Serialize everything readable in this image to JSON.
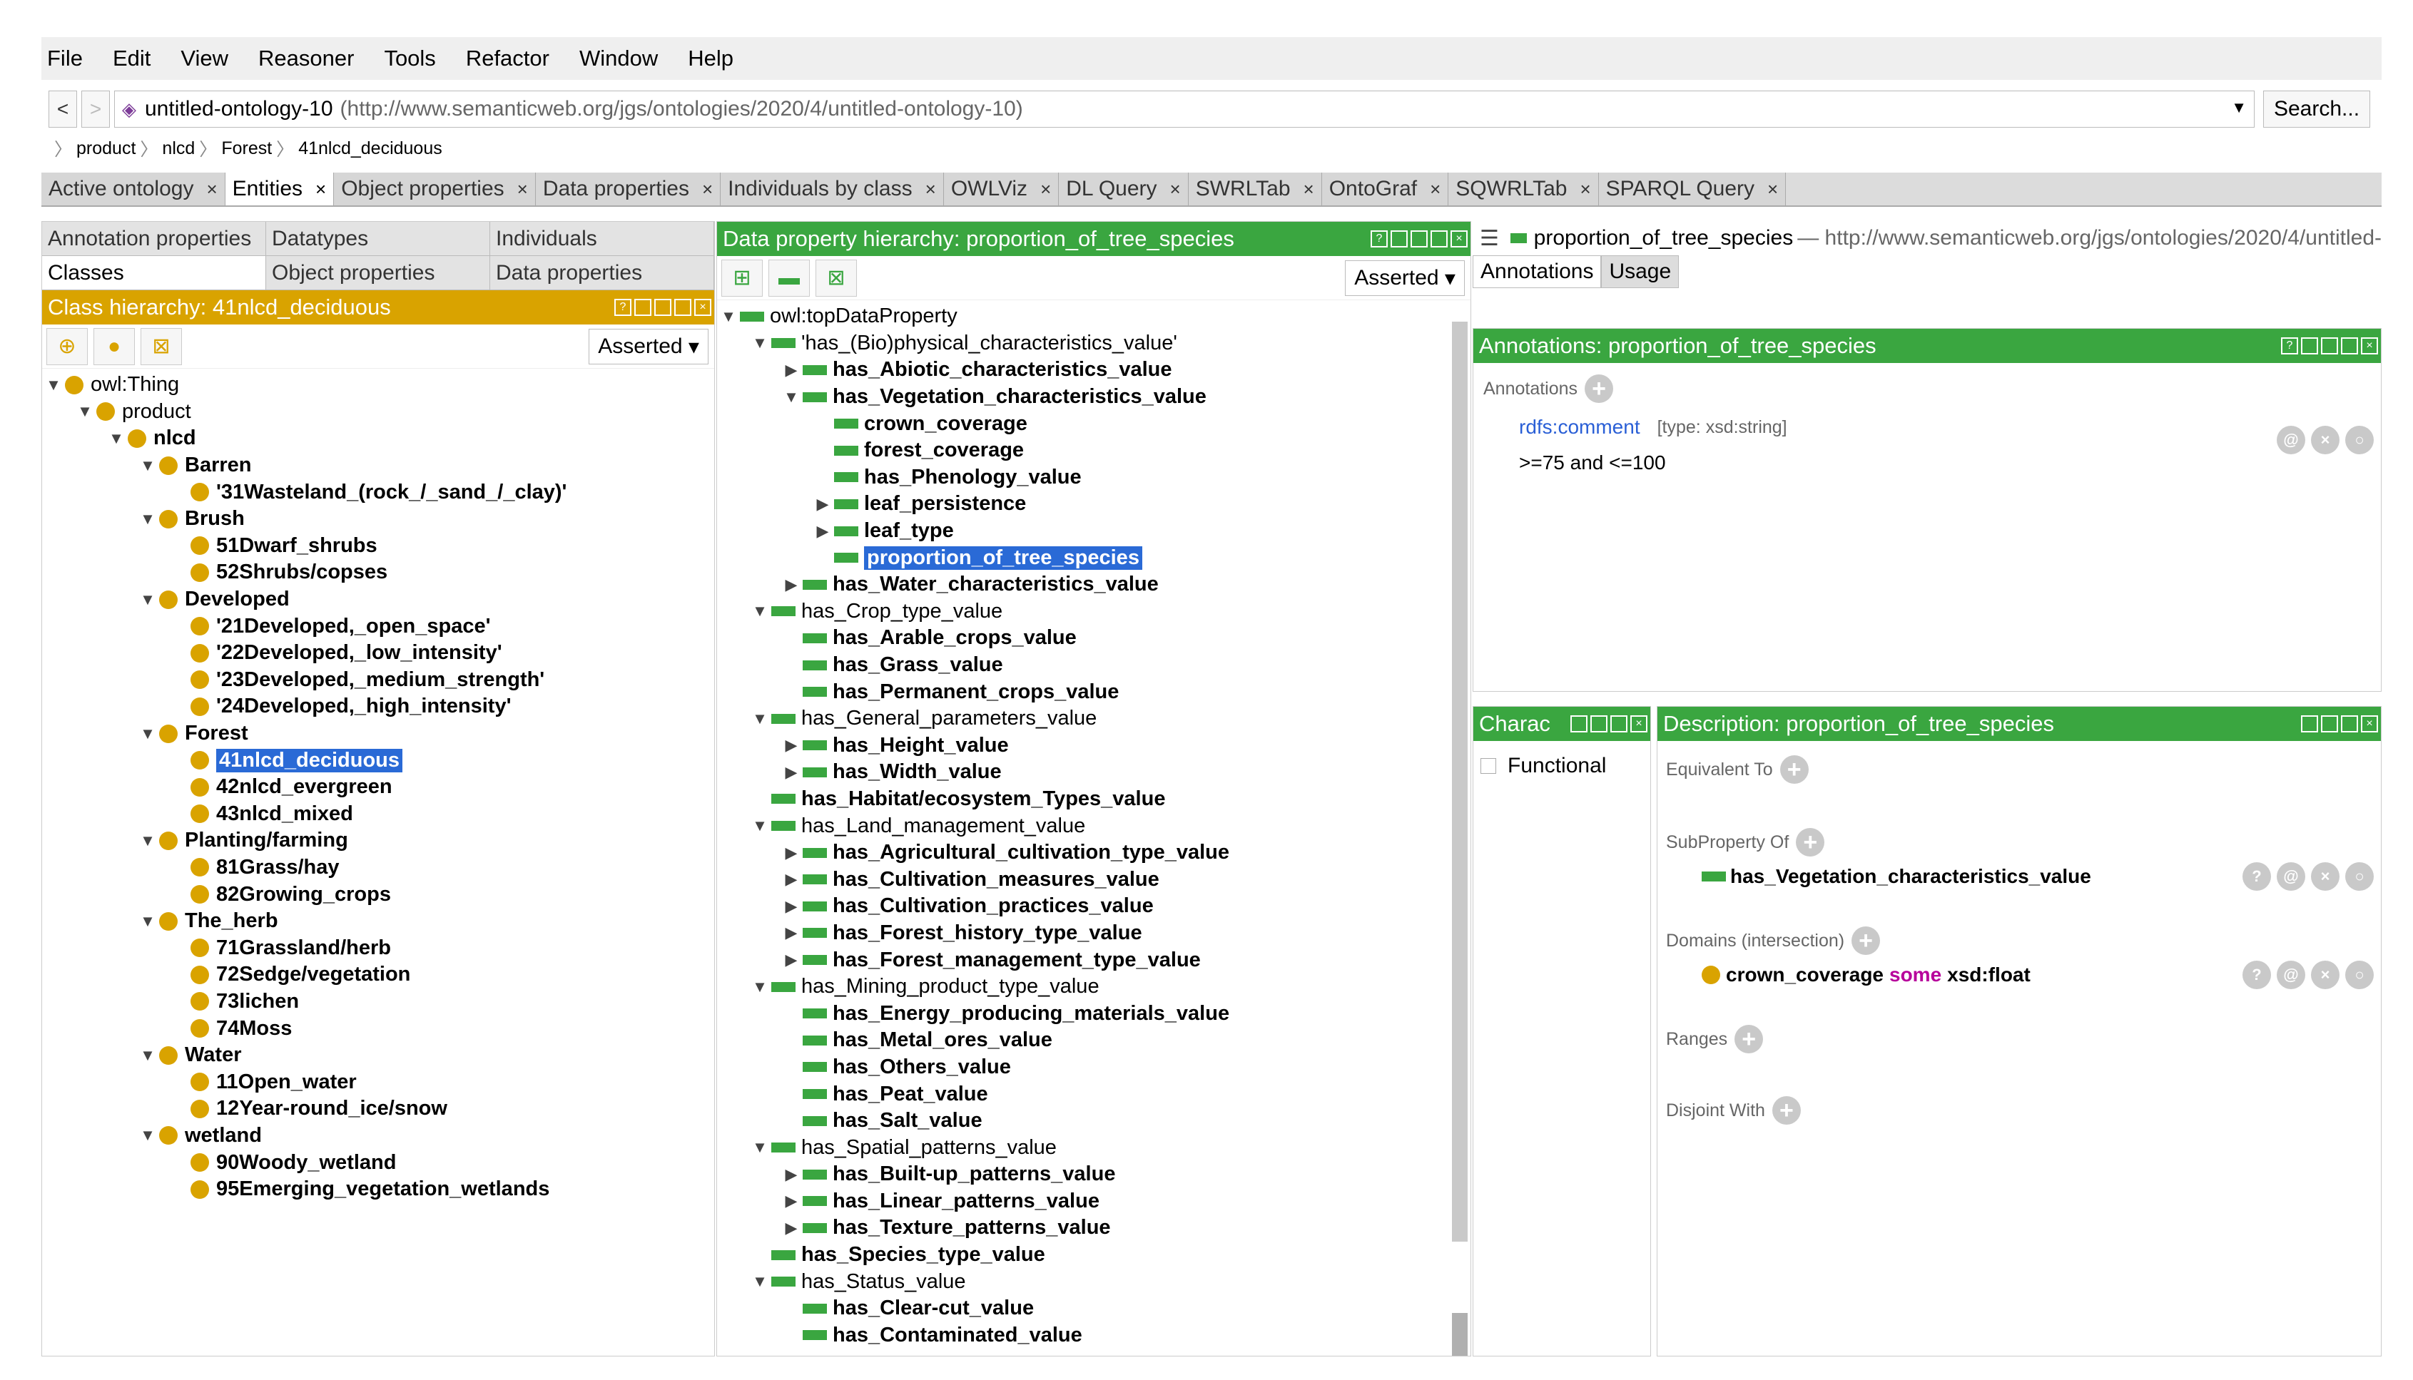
{
  "menu": [
    "File",
    "Edit",
    "View",
    "Reasoner",
    "Tools",
    "Refactor",
    "Window",
    "Help"
  ],
  "address": {
    "back": "<",
    "forward": ">",
    "ontology_name": "untitled-ontology-10",
    "ontology_uri": "(http://www.semanticweb.org/jgs/ontologies/2020/4/untitled-ontology-10)",
    "search_label": "Search..."
  },
  "breadcrumb": [
    "product",
    "nlcd",
    "Forest",
    "41nlcd_deciduous"
  ],
  "workspace_tabs": [
    {
      "label": "Active ontology",
      "active": false
    },
    {
      "label": "Entities",
      "active": true
    },
    {
      "label": "Object properties",
      "active": false
    },
    {
      "label": "Data properties",
      "active": false
    },
    {
      "label": "Individuals by class",
      "active": false
    },
    {
      "label": "OWLViz",
      "active": false
    },
    {
      "label": "DL Query",
      "active": false
    },
    {
      "label": "SWRLTab",
      "active": false
    },
    {
      "label": "OntoGraf",
      "active": false
    },
    {
      "label": "SQWRLTab",
      "active": false
    },
    {
      "label": "SPARQL Query",
      "active": false
    }
  ],
  "left": {
    "tabs_row1": [
      "Annotation properties",
      "Datatypes",
      "Individuals"
    ],
    "tabs_row2": [
      "Classes",
      "Object properties",
      "Data properties"
    ],
    "header": "Class hierarchy: 41nlcd_deciduous",
    "asserted": "Asserted",
    "tree": [
      {
        "label": "owl:Thing",
        "depth": 0,
        "toggle": "▼",
        "bold": false
      },
      {
        "label": "product",
        "depth": 1,
        "toggle": "▼",
        "bold": false
      },
      {
        "label": "nlcd",
        "depth": 2,
        "toggle": "▼",
        "bold": true
      },
      {
        "label": "Barren",
        "depth": 3,
        "toggle": "▼",
        "bold": true
      },
      {
        "label": "'31Wasteland_(rock_/_sand_/_clay)'",
        "depth": 4,
        "toggle": "",
        "bold": true
      },
      {
        "label": "Brush",
        "depth": 3,
        "toggle": "▼",
        "bold": true
      },
      {
        "label": "51Dwarf_shrubs",
        "depth": 4,
        "toggle": "",
        "bold": true
      },
      {
        "label": "52Shrubs/copses",
        "depth": 4,
        "toggle": "",
        "bold": true
      },
      {
        "label": "Developed",
        "depth": 3,
        "toggle": "▼",
        "bold": true
      },
      {
        "label": "'21Developed,_open_space'",
        "depth": 4,
        "toggle": "",
        "bold": true
      },
      {
        "label": "'22Developed,_low_intensity'",
        "depth": 4,
        "toggle": "",
        "bold": true
      },
      {
        "label": "'23Developed,_medium_strength'",
        "depth": 4,
        "toggle": "",
        "bold": true
      },
      {
        "label": "'24Developed,_high_intensity'",
        "depth": 4,
        "toggle": "",
        "bold": true
      },
      {
        "label": "Forest",
        "depth": 3,
        "toggle": "▼",
        "bold": true
      },
      {
        "label": "41nlcd_deciduous",
        "depth": 4,
        "toggle": "",
        "bold": true,
        "selected": true
      },
      {
        "label": "42nlcd_evergreen",
        "depth": 4,
        "toggle": "",
        "bold": true
      },
      {
        "label": "43nlcd_mixed",
        "depth": 4,
        "toggle": "",
        "bold": true
      },
      {
        "label": "Planting/farming",
        "depth": 3,
        "toggle": "▼",
        "bold": true
      },
      {
        "label": "81Grass/hay",
        "depth": 4,
        "toggle": "",
        "bold": true
      },
      {
        "label": "82Growing_crops",
        "depth": 4,
        "toggle": "",
        "bold": true
      },
      {
        "label": "The_herb",
        "depth": 3,
        "toggle": "▼",
        "bold": true
      },
      {
        "label": "71Grassland/herb",
        "depth": 4,
        "toggle": "",
        "bold": true
      },
      {
        "label": "72Sedge/vegetation",
        "depth": 4,
        "toggle": "",
        "bold": true
      },
      {
        "label": "73lichen",
        "depth": 4,
        "toggle": "",
        "bold": true
      },
      {
        "label": "74Moss",
        "depth": 4,
        "toggle": "",
        "bold": true
      },
      {
        "label": "Water",
        "depth": 3,
        "toggle": "▼",
        "bold": true
      },
      {
        "label": "11Open_water",
        "depth": 4,
        "toggle": "",
        "bold": true
      },
      {
        "label": "12Year-round_ice/snow",
        "depth": 4,
        "toggle": "",
        "bold": true
      },
      {
        "label": "wetland",
        "depth": 3,
        "toggle": "▼",
        "bold": true
      },
      {
        "label": "90Woody_wetland",
        "depth": 4,
        "toggle": "",
        "bold": true
      },
      {
        "label": "95Emerging_vegetation_wetlands",
        "depth": 4,
        "toggle": "",
        "bold": true
      }
    ]
  },
  "middle": {
    "header": "Data property hierarchy: proportion_of_tree_species",
    "asserted": "Asserted",
    "tree": [
      {
        "label": "owl:topDataProperty",
        "depth": 0,
        "toggle": "▼",
        "bold": false
      },
      {
        "label": "'has_(Bio)physical_characteristics_value'",
        "depth": 1,
        "toggle": "▼",
        "bold": false
      },
      {
        "label": "has_Abiotic_characteristics_value",
        "depth": 2,
        "toggle": "▶",
        "bold": true
      },
      {
        "label": "has_Vegetation_characteristics_value",
        "depth": 2,
        "toggle": "▼",
        "bold": true
      },
      {
        "label": "crown_coverage",
        "depth": 3,
        "toggle": "",
        "bold": true
      },
      {
        "label": "forest_coverage",
        "depth": 3,
        "toggle": "",
        "bold": true
      },
      {
        "label": "has_Phenology_value",
        "depth": 3,
        "toggle": "",
        "bold": true
      },
      {
        "label": "leaf_persistence",
        "depth": 3,
        "toggle": "▶",
        "bold": true
      },
      {
        "label": "leaf_type",
        "depth": 3,
        "toggle": "▶",
        "bold": true
      },
      {
        "label": "proportion_of_tree_species",
        "depth": 3,
        "toggle": "",
        "bold": true,
        "selected": true
      },
      {
        "label": "has_Water_characteristics_value",
        "depth": 2,
        "toggle": "▶",
        "bold": true
      },
      {
        "label": "has_Crop_type_value",
        "depth": 1,
        "toggle": "▼",
        "bold": false
      },
      {
        "label": "has_Arable_crops_value",
        "depth": 2,
        "toggle": "",
        "bold": true
      },
      {
        "label": "has_Grass_value",
        "depth": 2,
        "toggle": "",
        "bold": true
      },
      {
        "label": "has_Permanent_crops_value",
        "depth": 2,
        "toggle": "",
        "bold": true
      },
      {
        "label": "has_General_parameters_value",
        "depth": 1,
        "toggle": "▼",
        "bold": false
      },
      {
        "label": "has_Height_value",
        "depth": 2,
        "toggle": "▶",
        "bold": true
      },
      {
        "label": "has_Width_value",
        "depth": 2,
        "toggle": "▶",
        "bold": true
      },
      {
        "label": "has_Habitat/ecosystem_Types_value",
        "depth": 1,
        "toggle": "",
        "bold": true
      },
      {
        "label": "has_Land_management_value",
        "depth": 1,
        "toggle": "▼",
        "bold": false
      },
      {
        "label": "has_Agricultural_cultivation_type_value",
        "depth": 2,
        "toggle": "▶",
        "bold": true
      },
      {
        "label": "has_Cultivation_measures_value",
        "depth": 2,
        "toggle": "▶",
        "bold": true
      },
      {
        "label": "has_Cultivation_practices_value",
        "depth": 2,
        "toggle": "▶",
        "bold": true
      },
      {
        "label": "has_Forest_history_type_value",
        "depth": 2,
        "toggle": "▶",
        "bold": true
      },
      {
        "label": "has_Forest_management_type_value",
        "depth": 2,
        "toggle": "▶",
        "bold": true
      },
      {
        "label": "has_Mining_product_type_value",
        "depth": 1,
        "toggle": "▼",
        "bold": false
      },
      {
        "label": "has_Energy_producing_materials_value",
        "depth": 2,
        "toggle": "",
        "bold": true
      },
      {
        "label": "has_Metal_ores_value",
        "depth": 2,
        "toggle": "",
        "bold": true
      },
      {
        "label": "has_Others_value",
        "depth": 2,
        "toggle": "",
        "bold": true
      },
      {
        "label": "has_Peat_value",
        "depth": 2,
        "toggle": "",
        "bold": true
      },
      {
        "label": "has_Salt_value",
        "depth": 2,
        "toggle": "",
        "bold": true
      },
      {
        "label": "has_Spatial_patterns_value",
        "depth": 1,
        "toggle": "▼",
        "bold": false
      },
      {
        "label": "has_Built-up_patterns_value",
        "depth": 2,
        "toggle": "▶",
        "bold": true
      },
      {
        "label": "has_Linear_patterns_value",
        "depth": 2,
        "toggle": "▶",
        "bold": true
      },
      {
        "label": "has_Texture_patterns_value",
        "depth": 2,
        "toggle": "▶",
        "bold": true
      },
      {
        "label": "has_Species_type_value",
        "depth": 1,
        "toggle": "",
        "bold": true
      },
      {
        "label": "has_Status_value",
        "depth": 1,
        "toggle": "▼",
        "bold": false
      },
      {
        "label": "has_Clear-cut_value",
        "depth": 2,
        "toggle": "",
        "bold": true
      },
      {
        "label": "has_Contaminated_value",
        "depth": 2,
        "toggle": "",
        "bold": true
      }
    ]
  },
  "right": {
    "entity_name": "proportion_of_tree_species",
    "entity_uri": "— http://www.semanticweb.org/jgs/ontologies/2020/4/untitled-",
    "tabs": [
      "Annotations",
      "Usage"
    ],
    "annotations_header": "Annotations: proportion_of_tree_species",
    "annotations_label": "Annotations",
    "annotation_property": "rdfs:comment",
    "annotation_type": "[type: xsd:string]",
    "annotation_value": ">=75 and <=100",
    "char_header": "Charac",
    "functional_label": "Functional",
    "desc_header": "Description: proportion_of_tree_species",
    "equivalent_to": "Equivalent To",
    "subproperty_of": "SubProperty Of",
    "subproperty_value": "has_Vegetation_characteristics_value",
    "domains": "Domains (intersection)",
    "domain_class": "crown_coverage",
    "domain_keyword": "some",
    "domain_type": "xsd:float",
    "ranges": "Ranges",
    "disjoint_with": "Disjoint With"
  },
  "colors": {
    "class_gold": "#d9a300",
    "property_green": "#3aa640",
    "selection_blue": "#2a6ad6",
    "keyword_magenta": "#b7009b"
  }
}
